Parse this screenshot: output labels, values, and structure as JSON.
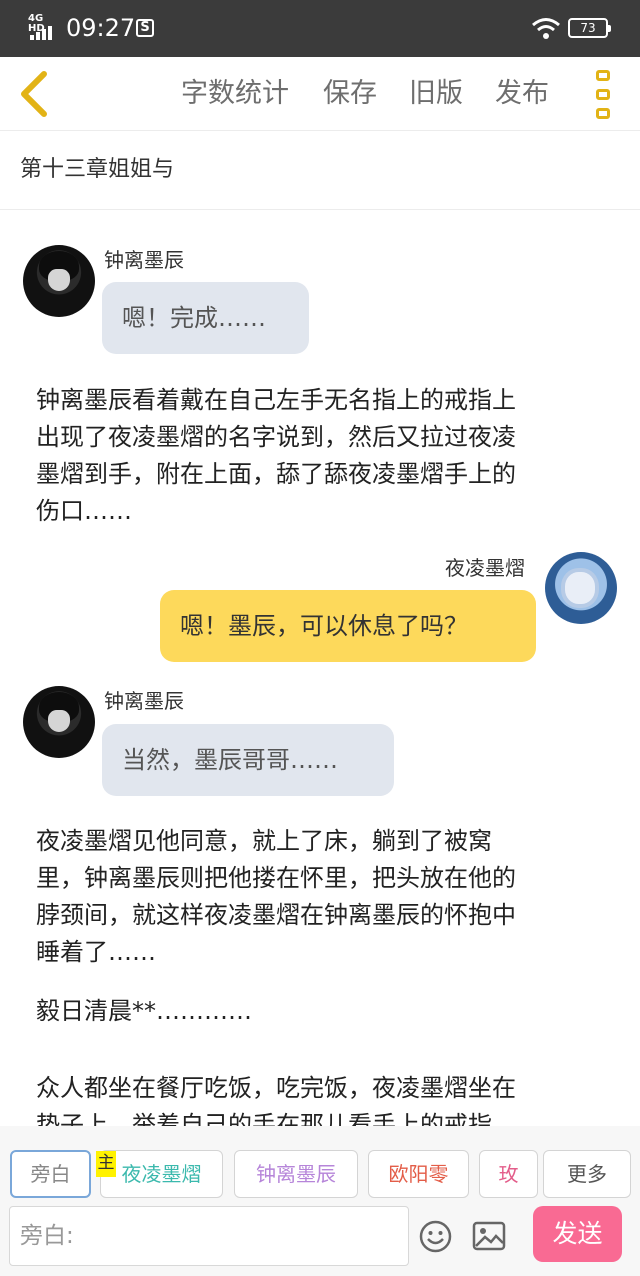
{
  "status_bar": {
    "network": "4G HD",
    "time": "09:27",
    "notification_icon": "s-icon",
    "battery": "73"
  },
  "toolbar": {
    "back_icon": "chevron-left-icon",
    "word_count": "字数统计",
    "save": "保存",
    "old_version": "旧版",
    "publish": "发布",
    "more_icon": "more-vertical-icon",
    "accent_color": "#e2b316"
  },
  "chapter": {
    "title": "第十三章姐姐与"
  },
  "messages": [
    {
      "type": "chat",
      "side": "left",
      "speaker": "钟离墨辰",
      "text": "嗯！完成……"
    },
    {
      "type": "narration",
      "lines": [
        "钟离墨辰看着戴在自己左手无名指上的戒指上",
        "出现了夜凌墨熠的名字说到，然后又拉过夜凌",
        "墨熠到手，附在上面，舔了舔夜凌墨熠手上的",
        "伤口……"
      ]
    },
    {
      "type": "chat",
      "side": "right",
      "speaker": "夜凌墨熠",
      "text": "嗯！墨辰，可以休息了吗？"
    },
    {
      "type": "chat",
      "side": "left",
      "speaker": "钟离墨辰",
      "text": "当然，墨辰哥哥……"
    },
    {
      "type": "narration",
      "lines": [
        "夜凌墨熠见他同意，就上了床，躺到了被窝",
        "里，钟离墨辰则把他搂在怀里，把头放在他的",
        "脖颈间，就这样夜凌墨熠在钟离墨辰的怀抱中",
        "睡着了……"
      ]
    },
    {
      "type": "narration",
      "lines": [
        "毅日清晨**…………"
      ]
    },
    {
      "type": "narration",
      "lines": [
        "众人都坐在餐厅吃饭，吃完饭，夜凌墨熠坐在",
        "垫子上，举着自己的手在那儿看手上的戒指"
      ]
    }
  ],
  "roles": [
    {
      "label": "旁白",
      "color": "#888888"
    },
    {
      "label": "夜凌墨熠",
      "color": "#3bb9ad",
      "main_tag": "主"
    },
    {
      "label": "钟离墨辰",
      "color": "#b685d9"
    },
    {
      "label": "欧阳零",
      "color": "#e35d48"
    },
    {
      "label": "玫",
      "color": "#e35d8a"
    },
    {
      "label": "更多",
      "color": "#555555"
    }
  ],
  "input": {
    "placeholder": "旁白:",
    "emoji_icon": "emoji-icon",
    "image_icon": "image-icon",
    "send": "发送",
    "send_color": "#f96a93"
  }
}
